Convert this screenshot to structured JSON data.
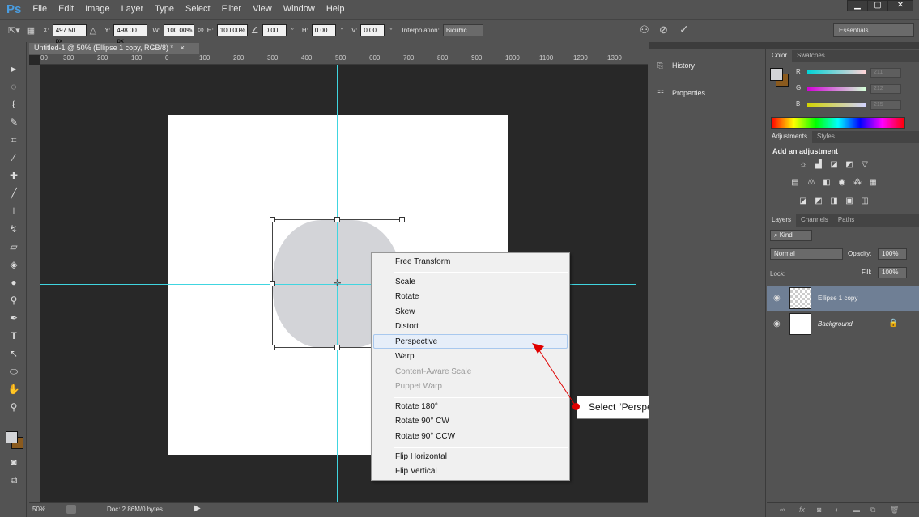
{
  "app": {
    "logo": "Ps"
  },
  "menu": [
    "File",
    "Edit",
    "Image",
    "Layer",
    "Type",
    "Select",
    "Filter",
    "View",
    "Window",
    "Help"
  ],
  "window_controls": {
    "minimize": "▁",
    "maximize": "▢",
    "close": "✕"
  },
  "options_bar": {
    "x_label": "X:",
    "x_value": "497.50 px",
    "y_label": "Y:",
    "y_value": "498.00 px",
    "w_label": "W:",
    "w_value": "100.00%",
    "h_label": "H:",
    "h_value": "100.00%",
    "angle_value": "0.00",
    "hskew_label": "H:",
    "hskew_value": "0.00",
    "vskew_label": "V:",
    "vskew_value": "0.00",
    "interp_label": "Interpolation:",
    "interp_value": "Bicubic",
    "workspace": "Essentials",
    "degree": "°"
  },
  "document": {
    "tab_title": "Untitled-1 @ 50% (Ellipse 1 copy, RGB/8) *",
    "tab_close": "×",
    "ruler_ticks": [
      "00",
      "300",
      "200",
      "100",
      "0",
      "100",
      "200",
      "300",
      "400",
      "500",
      "600",
      "700",
      "800",
      "900",
      "1000",
      "1100",
      "1200",
      "1300"
    ]
  },
  "status": {
    "zoom": "50%",
    "doc_info": "Doc: 2.86M/0 bytes"
  },
  "context_menu": {
    "items": [
      {
        "label": "Free Transform",
        "disabled": false
      },
      {
        "label": "Scale",
        "disabled": false
      },
      {
        "label": "Rotate",
        "disabled": false
      },
      {
        "label": "Skew",
        "disabled": false
      },
      {
        "label": "Distort",
        "disabled": false
      },
      {
        "label": "Perspective",
        "disabled": false,
        "highlighted": true
      },
      {
        "label": "Warp",
        "disabled": false
      },
      {
        "label": "Content-Aware Scale",
        "disabled": true
      },
      {
        "label": "Puppet Warp",
        "disabled": true
      },
      {
        "label": "Rotate 180°",
        "disabled": false
      },
      {
        "label": "Rotate 90° CW",
        "disabled": false
      },
      {
        "label": "Rotate 90° CCW",
        "disabled": false
      },
      {
        "label": "Flip Horizontal",
        "disabled": false
      },
      {
        "label": "Flip Vertical",
        "disabled": false
      }
    ]
  },
  "callout": {
    "text": "Select “Perspective” option",
    "color": "#e00000"
  },
  "mid_panel": {
    "history": "History",
    "properties": "Properties"
  },
  "color_panel": {
    "tabs": [
      "Color",
      "Swatches"
    ],
    "r_label": "R",
    "r_value": "211",
    "g_label": "G",
    "g_value": "212",
    "b_label": "B",
    "b_value": "215",
    "foreground": "#d3d4d7",
    "background": "#8a5a1e"
  },
  "adjustments_panel": {
    "tabs": [
      "Adjustments",
      "Styles"
    ],
    "title": "Add an adjustment"
  },
  "layers_panel": {
    "tabs": [
      "Layers",
      "Channels",
      "Paths"
    ],
    "kind_label": "Kind",
    "blend_mode": "Normal",
    "opacity_label": "Opacity:",
    "opacity_value": "100%",
    "lock_label": "Lock:",
    "fill_label": "Fill:",
    "fill_value": "100%",
    "layers": [
      {
        "name": "Ellipse 1 copy",
        "selected": true
      },
      {
        "name": "Background",
        "selected": false
      }
    ]
  }
}
